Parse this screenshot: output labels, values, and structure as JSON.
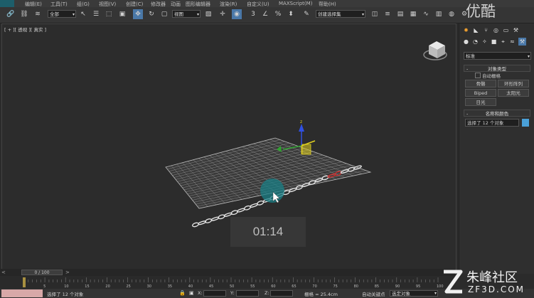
{
  "menu": [
    "编辑(E)",
    "工具(T)",
    "组(G)",
    "视图(V)",
    "创建(C)",
    "修改器",
    "动画",
    "图形编辑器",
    "渲染(R)",
    "自定义(U)",
    "MAXScript(M)",
    "帮助(H)"
  ],
  "toolbar": {
    "selection_filter": "全部",
    "ref_coord": "视图",
    "named_selection": "创建选择集"
  },
  "viewport": {
    "label": "[ + ][ 透视 ][ 真实 ]",
    "timer": "01:14"
  },
  "panel": {
    "category": "标准",
    "object_type_header": "对象类型",
    "autogrid": "自动栅格",
    "buttons": [
      "骨骼",
      "环形阵列",
      "Biped",
      "太阳光",
      "日光"
    ],
    "name_color_header": "名称和颜色",
    "selection_name": "选择了 12 个对象",
    "selection_color": "#4aa0d8"
  },
  "timeline": {
    "frame_counter": "0 / 100",
    "ticks": [
      "0",
      "5",
      "10",
      "15",
      "20",
      "25",
      "30",
      "35",
      "40",
      "45",
      "50",
      "55",
      "60",
      "65",
      "70",
      "75",
      "80",
      "85",
      "90",
      "95",
      "100"
    ]
  },
  "status": {
    "selection_text": "选择了 12 个对象",
    "x_label": "X:",
    "y_label": "Y:",
    "z_label": "Z:",
    "grid_text": "栅格 = 25.4cm",
    "auto_key": "自动关键点",
    "key_filter": "选定对象"
  },
  "watermark": {
    "top": "优酷",
    "bottom_site": "朱峰社区",
    "bottom_url": "ZF3D.COM"
  },
  "colors": {
    "active_button": "#4a78a8",
    "chain_accent": "#d03030",
    "gizmo_y": "#e0d020",
    "gizmo_z": "#3050e0",
    "gizmo_x": "#30a030",
    "cursor_highlight": "#1a7f86"
  }
}
